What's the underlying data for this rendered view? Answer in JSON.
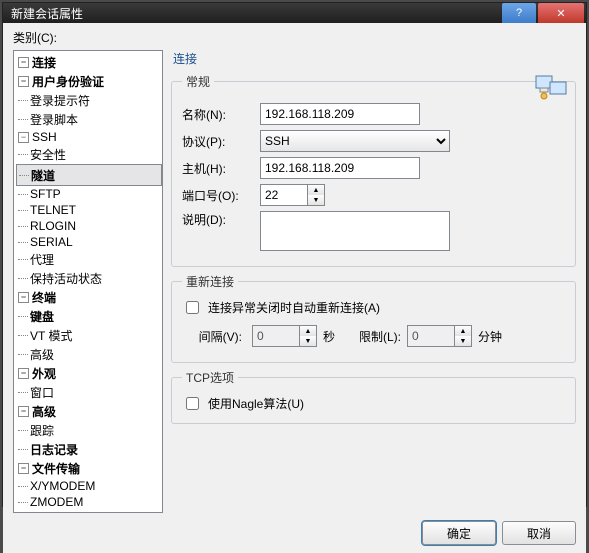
{
  "window": {
    "title": "新建会话属性"
  },
  "category_label": "类别(C):",
  "tree": {
    "items": [
      {
        "lv": 0,
        "exp": "-",
        "bold": true,
        "label": "连接"
      },
      {
        "lv": 1,
        "exp": "-",
        "bold": true,
        "label": "用户身份验证"
      },
      {
        "lv": 2,
        "label": "登录提示符"
      },
      {
        "lv": 2,
        "label": "登录脚本"
      },
      {
        "lv": 1,
        "exp": "-",
        "label": "SSH"
      },
      {
        "lv": 2,
        "label": "安全性"
      },
      {
        "lv": 2,
        "bold": true,
        "sel": true,
        "label": "隧道"
      },
      {
        "lv": 2,
        "label": "SFTP"
      },
      {
        "lv": 1,
        "label": "TELNET"
      },
      {
        "lv": 1,
        "label": "RLOGIN"
      },
      {
        "lv": 1,
        "label": "SERIAL"
      },
      {
        "lv": 1,
        "label": "代理"
      },
      {
        "lv": 1,
        "label": "保持活动状态"
      },
      {
        "lv": 0,
        "exp": "-",
        "bold": true,
        "label": "终端"
      },
      {
        "lv": 1,
        "bold": true,
        "label": "键盘"
      },
      {
        "lv": 1,
        "label": "VT 模式"
      },
      {
        "lv": 1,
        "label": "高级"
      },
      {
        "lv": 0,
        "exp": "-",
        "bold": true,
        "label": "外观"
      },
      {
        "lv": 1,
        "label": "窗口"
      },
      {
        "lv": 0,
        "exp": "-",
        "bold": true,
        "label": "高级"
      },
      {
        "lv": 1,
        "label": "跟踪"
      },
      {
        "lv": 1,
        "bold": true,
        "label": "日志记录"
      },
      {
        "lv": 0,
        "exp": "-",
        "bold": true,
        "label": "文件传输"
      },
      {
        "lv": 1,
        "label": "X/YMODEM"
      },
      {
        "lv": 1,
        "label": "ZMODEM"
      }
    ]
  },
  "main": {
    "title": "连接",
    "general": {
      "legend": "常规",
      "name_label": "名称(N):",
      "name_value": "192.168.118.209",
      "proto_label": "协议(P):",
      "proto_value": "SSH",
      "host_label": "主机(H):",
      "host_value": "192.168.118.209",
      "port_label": "端口号(O):",
      "port_value": "22",
      "desc_label": "说明(D):",
      "desc_value": ""
    },
    "reconnect": {
      "legend": "重新连接",
      "auto_label": "连接异常关闭时自动重新连接(A)",
      "interval_label": "间隔(V):",
      "interval_value": "0",
      "sec_label": "秒",
      "limit_label": "限制(L):",
      "limit_value": "0",
      "min_label": "分钟"
    },
    "tcp": {
      "legend": "TCP选项",
      "nagle_label": "使用Nagle算法(U)"
    }
  },
  "buttons": {
    "ok": "确定",
    "cancel": "取消"
  }
}
